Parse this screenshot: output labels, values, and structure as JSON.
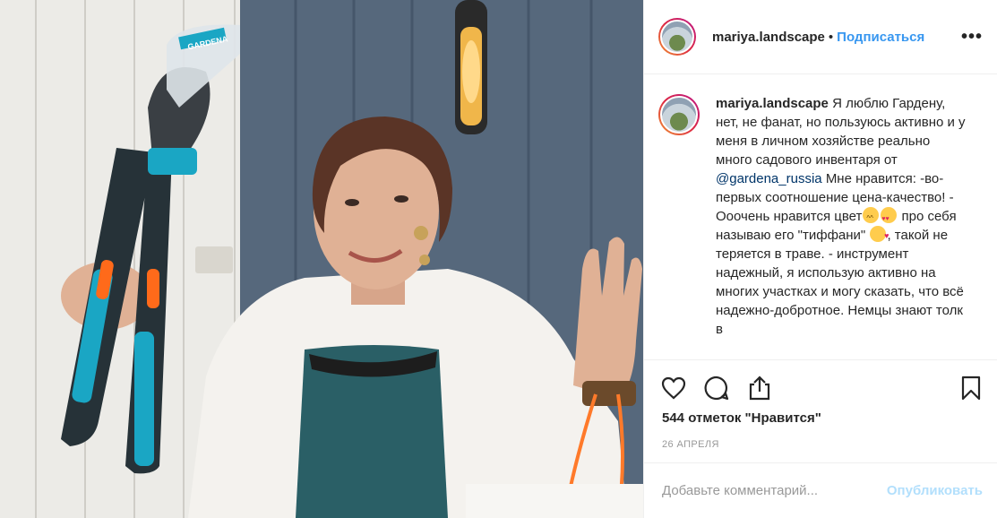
{
  "header": {
    "username": "mariya.landscape",
    "separator": "•",
    "follow_label": "Подписаться",
    "more_label": "•••"
  },
  "caption": {
    "username": "mariya.landscape",
    "text_1": "Я люблю Гардену, нет, не фанат, но пользуюсь активно и у меня в личном хозяйстве реально много садового инвентаря от",
    "mention": "@gardena_russia",
    "text_2": "Мне нравится: -во-первых соотношение цена-качество! - Ооочень нравится цвет",
    "text_3": "про себя называю его \"тиффани\"",
    "text_4": ", такой не теряется в траве. - инструмент надежный, я использую активно на многих участках и могу сказать, что всё надежно-добротное. Немцы знают толк в"
  },
  "photo": {
    "package_brand": "GARDENA"
  },
  "likes": "544 отметок \"Нравится\"",
  "date": "26 АПРЕЛЯ",
  "comment_box": {
    "placeholder": "Добавьте комментарий...",
    "publish_label": "Опубликовать"
  },
  "colors": {
    "accent": "#3897f0",
    "mention": "#003569",
    "tool_teal": "#1aa6c4",
    "tool_orange": "#ff6a1a"
  },
  "icons": [
    "heart-icon",
    "comment-icon",
    "share-icon",
    "bookmark-icon"
  ]
}
